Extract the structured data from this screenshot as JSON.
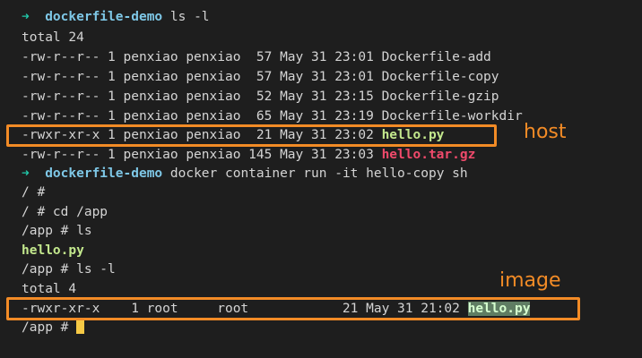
{
  "terminal": {
    "l1": {
      "arrow": "➜",
      "dir": "dockerfile-demo",
      "cmd": " ls -l"
    },
    "l2": "total 24",
    "l3": "-rw-r--r-- 1 penxiao penxiao  57 May 31 23:01 Dockerfile-add",
    "l4": "-rw-r--r-- 1 penxiao penxiao  57 May 31 23:01 Dockerfile-copy",
    "l5": "-rw-r--r-- 1 penxiao penxiao  52 May 31 23:15 Dockerfile-gzip",
    "l6": "-rw-r--r-- 1 penxiao penxiao  65 May 31 23:19 Dockerfile-workdir",
    "l7": {
      "prefix": "-rwxr-xr-x 1 penxiao penxiao  21 May 31 23:02 ",
      "file": "hello.py"
    },
    "l8": {
      "prefix": "-rw-r--r-- 1 penxiao penxiao 145 May 31 23:03 ",
      "file": "hello.tar.gz"
    },
    "l9": {
      "arrow": "➜",
      "dir": "dockerfile-demo",
      "cmd": " docker container run -it hello-copy sh"
    },
    "l10": "/ #",
    "l11": "/ # cd /app",
    "l12": "/app # ls",
    "l13": "hello.py",
    "l14": "/app # ls -l",
    "l15": "total 4",
    "l16": {
      "prefix": "-rwxr-xr-x    1 root     root            21 May 31 21:02 ",
      "file": "hello.py"
    },
    "l17": "/app # "
  },
  "annotations": {
    "host_label": "host",
    "image_label": "image",
    "color": "#f28b26"
  }
}
